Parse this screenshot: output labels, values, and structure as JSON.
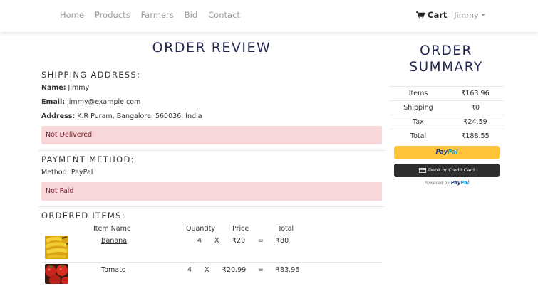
{
  "nav": {
    "links": [
      "Home",
      "Products",
      "Farmers",
      "Bid",
      "Contact"
    ],
    "cart_label": "Cart",
    "user_label": "Jimmy"
  },
  "page_title": "ORDER REVIEW",
  "shipping": {
    "heading": "SHIPPING ADDRESS:",
    "name_label": "Name:",
    "name": "Jimmy",
    "email_label": "Email:",
    "email": "jimmy@example.com",
    "address_label": "Address:",
    "address": "K.R Puram, Bangalore, 560036, India",
    "status": "Not Delivered"
  },
  "payment": {
    "heading": "PAYMENT METHOD:",
    "method_text": "Method: PayPal",
    "status": "Not Paid"
  },
  "items": {
    "heading": "ORDERED ITEMS:",
    "columns": {
      "name": "Item Name",
      "quantity": "Quantity",
      "price": "Price",
      "total": "Total"
    },
    "rows": [
      {
        "name": "Banana",
        "qty": "4",
        "x": "X",
        "price": "₹20",
        "eq": "=",
        "total": "₹80"
      },
      {
        "name": "Tomato",
        "qty": "4",
        "x": "X",
        "price": "₹20.99",
        "eq": "=",
        "total": "₹83.96"
      }
    ]
  },
  "summary": {
    "title_line1": "ORDER",
    "title_line2": "SUMMARY",
    "rows": [
      {
        "label": "Items",
        "value": "₹163.96"
      },
      {
        "label": "Shipping",
        "value": "₹0"
      },
      {
        "label": "Tax",
        "value": "₹24.59"
      },
      {
        "label": "Total",
        "value": "₹188.55"
      }
    ],
    "paypal_pay": "Pay",
    "paypal_pal": "Pal",
    "card_label": "Debit or Credit Card",
    "powered_prefix": "Powered by",
    "powered_pay": "Pay",
    "powered_pal": "Pal"
  },
  "colors": {
    "heading": "#232851",
    "alert_bg": "#f8d7da",
    "alert_text": "#721c24",
    "paypal_yellow": "#ffc439",
    "card_black": "#2c2e2f"
  }
}
